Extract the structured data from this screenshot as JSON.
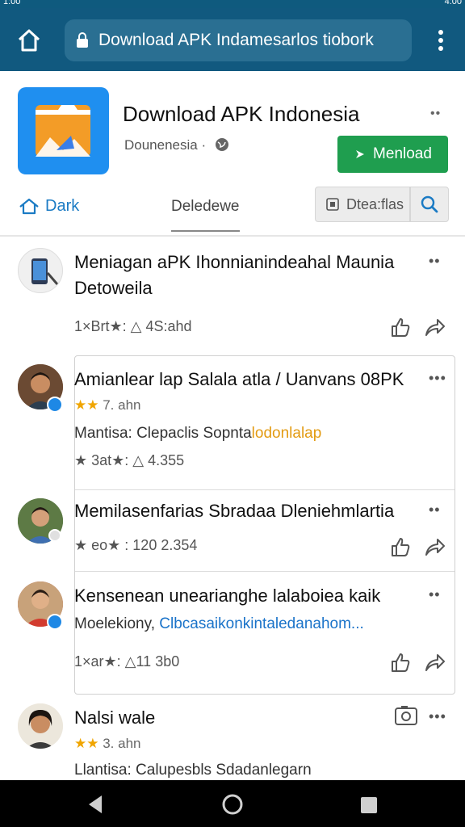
{
  "status_bar": {
    "time": "1:00",
    "right": "4:00"
  },
  "browser": {
    "url": "Download APK Indamesarlos tiobork",
    "icons": {
      "home": "home-icon",
      "lock": "lock-icon",
      "menu": "more-vert-icon"
    }
  },
  "app": {
    "title": "Download APK Indonesia",
    "subtitle": "Dounenesia ·",
    "download_label": "Menload",
    "colors": {
      "header": "#11597f",
      "download": "#1f9e4f",
      "accent": "#1b7bc4"
    }
  },
  "tabs": {
    "back": "Dark",
    "details": "Deledewe",
    "filter": "Dtea:flas"
  },
  "feed": [
    {
      "title_lines": [
        "Meniagan aPK Ihonnianindeahal Maunia",
        "Detoweila"
      ],
      "stats": "1×Brt★: △ 4S:ahd"
    },
    {
      "title": "Amianlear lap Salala atla / Uanvans 08PK",
      "rating_text": "7. ahn",
      "desc_plain": "Mantisa: Clepaclis Sopnta",
      "desc_highlight": "lodonlalap",
      "stats": "★ 3at★: △ 4.355"
    },
    {
      "title": "Memilasenfarias Sbradaa Dleniehmlartia",
      "stats": "★ eo★ : 120 2.354"
    },
    {
      "title": "Kensenean unearianghe lalaboiea kaik",
      "desc_plain": "Moelekiony,",
      "desc_link": "Clbcasaikonkintaledanahom...",
      "stats": "1×ar★: △11 3b0"
    },
    {
      "title": "Nalsi wale",
      "rating_text": "3. ahn",
      "desc_plain": "Llantisa: Calupesbls Sdadanlegarn"
    }
  ]
}
